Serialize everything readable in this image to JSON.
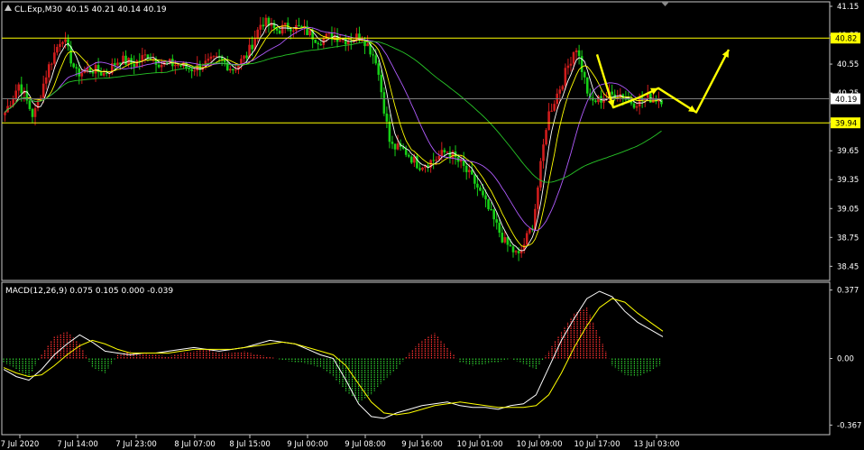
{
  "window": {
    "symbol_label": "CL.Exp,M30",
    "ohlc_label": "40.15 40.21 40.14 40.19"
  },
  "colors": {
    "background": "#000000",
    "frame": "#c8c8c8",
    "bull": "#d01c1c",
    "bear": "#17d017",
    "ma_fast": "#ffffff",
    "ma_mid": "#ffff00",
    "ma_slow": "#b15cff",
    "ma_long": "#27c627",
    "hline": "#ffff00",
    "arrow": "#ffff00",
    "hist_pos": "#ff3030",
    "hist_neg": "#2ecc2e",
    "macd_line": "#ffffff",
    "signal_line": "#ffff00"
  },
  "chart_data": [
    {
      "type": "candlestick",
      "title": "CL.Exp,M30",
      "ylim": [
        38.35,
        41.15
      ],
      "y_ticks": [
        41.15,
        40.85,
        40.55,
        40.25,
        39.95,
        39.65,
        39.35,
        39.05,
        38.75,
        38.45
      ],
      "price_labels": [
        "40.82",
        "40.19",
        "39.94"
      ],
      "h_levels": [
        40.82,
        39.94
      ],
      "current_price": 40.19,
      "x_ticks": [
        "7 Jul 2020",
        "7 Jul 14:00",
        "7 Jul 23:00",
        "8 Jul 07:00",
        "8 Jul 15:00",
        "9 Jul 00:00",
        "9 Jul 08:00",
        "9 Jul 16:00",
        "10 Jul 01:00",
        "10 Jul 09:00",
        "10 Jul 17:00",
        "13 Jul 03:00"
      ],
      "price_path": [
        40.05,
        40.35,
        40.0,
        40.5,
        40.85,
        40.45,
        40.5,
        40.45,
        40.6,
        40.55,
        40.65,
        40.55,
        40.55,
        40.5,
        40.55,
        40.6,
        40.5,
        40.65,
        41.0,
        40.9,
        40.95,
        40.9,
        40.8,
        40.85,
        40.8,
        40.85,
        40.6,
        39.7,
        39.65,
        39.5,
        39.55,
        39.65,
        39.5,
        39.3,
        39.0,
        38.7,
        38.55,
        38.9,
        40.0,
        40.35,
        40.75,
        40.15,
        40.2,
        40.25,
        40.15,
        40.2,
        40.19
      ],
      "overlay_arrow_path": [
        40.65,
        40.1,
        40.2,
        40.3,
        40.05,
        40.7
      ]
    },
    {
      "type": "macd",
      "title": "MACD(12,26,9) 0.075 0.105 0.000 -0.039",
      "ylim": [
        -0.4,
        0.4
      ],
      "y_ticks": [
        0.377,
        0.0,
        -0.367
      ],
      "histogram": [
        -0.02,
        -0.06,
        -0.1,
        0.02,
        0.12,
        0.15,
        0.08,
        -0.05,
        -0.08,
        0.02,
        0.04,
        0.03,
        0.02,
        0.01,
        0.03,
        0.04,
        0.05,
        0.03,
        0.03,
        0.04,
        0.02,
        0.01,
        -0.01,
        -0.02,
        -0.03,
        -0.05,
        -0.1,
        -0.18,
        -0.24,
        -0.2,
        -0.12,
        -0.06,
        0.03,
        0.1,
        0.14,
        0.06,
        -0.02,
        -0.04,
        -0.03,
        -0.02,
        0.0,
        -0.03,
        -0.06,
        0.04,
        0.15,
        0.25,
        0.28,
        0.12,
        -0.04,
        -0.09,
        -0.1,
        -0.07,
        -0.03
      ],
      "macd_line": [
        -0.06,
        -0.1,
        -0.12,
        -0.06,
        0.02,
        0.08,
        0.13,
        0.09,
        0.04,
        0.03,
        0.02,
        0.03,
        0.03,
        0.04,
        0.05,
        0.06,
        0.05,
        0.04,
        0.05,
        0.06,
        0.08,
        0.1,
        0.09,
        0.08,
        0.05,
        0.02,
        0.0,
        -0.12,
        -0.25,
        -0.32,
        -0.33,
        -0.3,
        -0.28,
        -0.26,
        -0.25,
        -0.24,
        -0.26,
        -0.27,
        -0.27,
        -0.28,
        -0.26,
        -0.25,
        -0.2,
        -0.05,
        0.1,
        0.22,
        0.33,
        0.37,
        0.34,
        0.26,
        0.2,
        0.16,
        0.12
      ],
      "signal_line": [
        -0.05,
        -0.08,
        -0.1,
        -0.09,
        -0.04,
        0.02,
        0.07,
        0.1,
        0.08,
        0.05,
        0.03,
        0.03,
        0.03,
        0.03,
        0.04,
        0.05,
        0.05,
        0.05,
        0.05,
        0.06,
        0.07,
        0.08,
        0.09,
        0.08,
        0.06,
        0.04,
        0.02,
        -0.04,
        -0.14,
        -0.24,
        -0.3,
        -0.31,
        -0.3,
        -0.28,
        -0.26,
        -0.25,
        -0.24,
        -0.25,
        -0.26,
        -0.27,
        -0.27,
        -0.27,
        -0.26,
        -0.2,
        -0.08,
        0.06,
        0.18,
        0.28,
        0.33,
        0.31,
        0.25,
        0.2,
        0.15
      ]
    }
  ]
}
